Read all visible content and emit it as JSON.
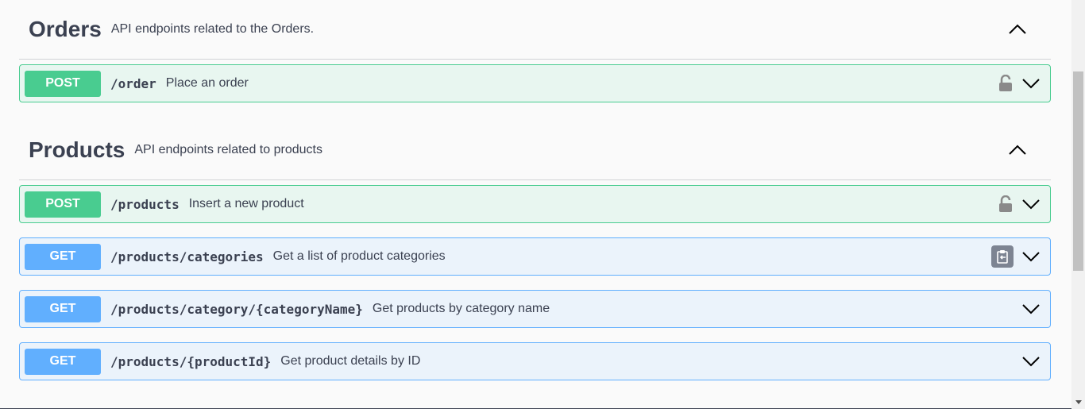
{
  "sections": [
    {
      "title": "Orders",
      "description": "API endpoints related to the Orders.",
      "operations": [
        {
          "method": "POST",
          "path": "/order",
          "summary": "Place an order"
        }
      ]
    },
    {
      "title": "Products",
      "description": "API endpoints related to products",
      "operations": [
        {
          "method": "POST",
          "path": "/products",
          "summary": "Insert a new product"
        },
        {
          "method": "GET",
          "path": "/products/categories",
          "summary": "Get a list of product categories"
        },
        {
          "method": "GET",
          "path": "/products/category/{categoryName}",
          "summary": "Get products by category name"
        },
        {
          "method": "GET",
          "path": "/products/{productId}",
          "summary": "Get product details by ID"
        }
      ]
    }
  ],
  "colors": {
    "post": "#49cc90",
    "get": "#61affe",
    "text": "#3b4151"
  }
}
